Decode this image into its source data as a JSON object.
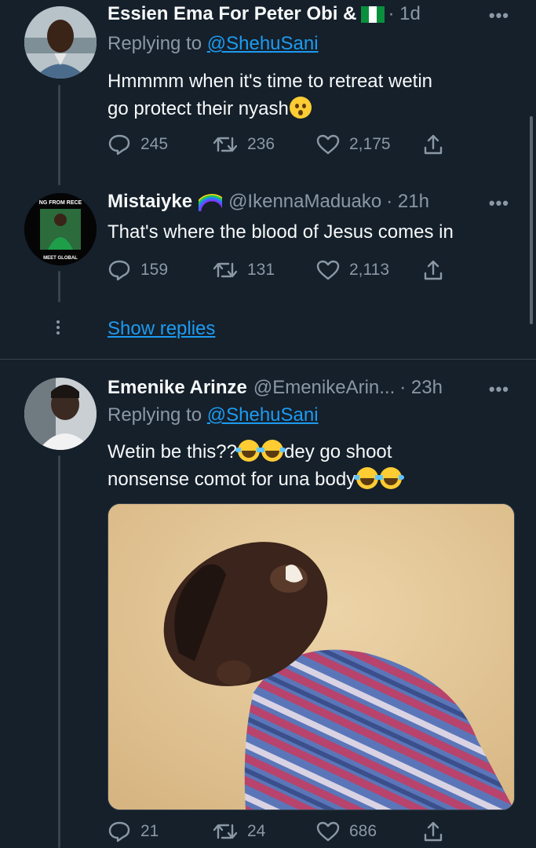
{
  "tweets": [
    {
      "name": "Essien Ema For Peter Obi &",
      "badge_icon": "nigeria-flag-icon",
      "time": "· 1d",
      "replying_prefix": "Replying to",
      "replying_to": "@ShehuSani",
      "text": "Hmmmm when it's time to retreat wetin go protect their nyash",
      "text_line1": "Hmmmm when it's time to retreat wetin",
      "text_line2": "go protect their nyash",
      "emoji": "astonished-face-emoji",
      "replies": "245",
      "retweets": "236",
      "likes": "2,175"
    },
    {
      "name": "Mistaiyke",
      "badge_icon": "rainbow-icon",
      "handle": "@IkennaMaduako",
      "time": "· 21h",
      "avatar_text_top": "NG FROM RECE",
      "avatar_text_bottom": "MEET GLOBAL",
      "text": "That's where the blood of Jesus comes in",
      "replies": "159",
      "retweets": "131",
      "likes": "2,113"
    },
    {
      "name": "Emenike Arinze",
      "handle": "@EmenikeArin...",
      "time": "· 23h",
      "replying_prefix": "Replying to",
      "replying_to": "@ShehuSani",
      "text_line1": "Wetin be this??",
      "text_line1_after": "dey go shoot",
      "text_line2": "nonsense comot for una body",
      "emoji": "face-with-tears-of-joy-emoji",
      "replies": "21",
      "retweets": "24",
      "likes": "686"
    }
  ],
  "show_replies": "Show replies",
  "more_label": "•••",
  "colors": {
    "background": "#15202b",
    "text": "#f7f9f9",
    "muted": "#8b98a5",
    "link": "#1d9bf0",
    "divider": "#38444d"
  }
}
